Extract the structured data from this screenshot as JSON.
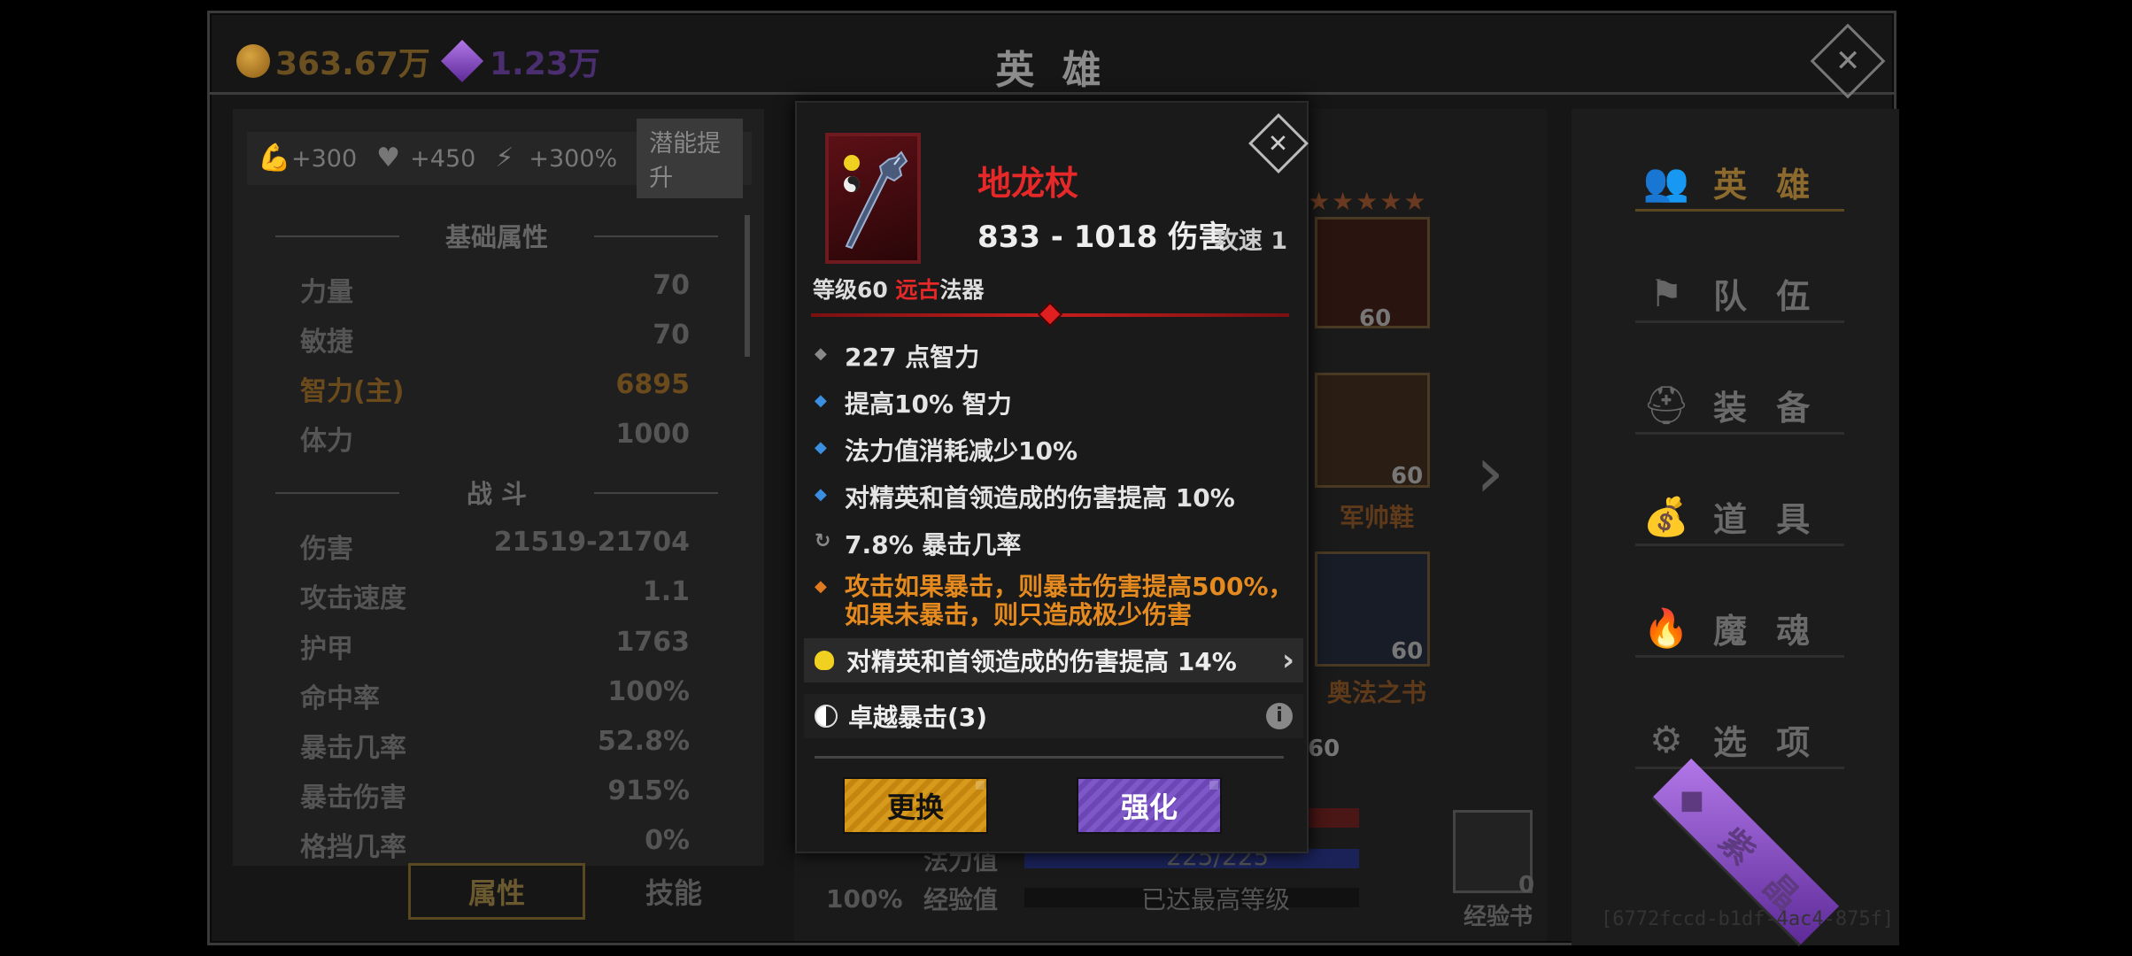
{
  "topbar": {
    "gold": "363.67万",
    "gems": "1.23万",
    "title": "英 雄"
  },
  "left": {
    "bonuses": [
      "+300",
      "+450",
      "+300%"
    ],
    "potential_btn": "潜能提升",
    "section_basic": "基础属性",
    "section_combat": "战 斗",
    "basic_stats": [
      {
        "label": "力量",
        "value": "70"
      },
      {
        "label": "敏捷",
        "value": "70"
      },
      {
        "label": "智力(主)",
        "value": "6895"
      },
      {
        "label": "体力",
        "value": "1000"
      }
    ],
    "combat_stats": [
      {
        "label": "伤害",
        "value": "21519-21704"
      },
      {
        "label": "攻击速度",
        "value": "1.1"
      },
      {
        "label": "护甲",
        "value": "1763"
      },
      {
        "label": "命中率",
        "value": "100%"
      },
      {
        "label": "暴击几率",
        "value": "52.8%"
      },
      {
        "label": "暴击伤害",
        "value": "915%"
      },
      {
        "label": "格挡几率",
        "value": "0%"
      }
    ],
    "tabs": [
      "属性",
      "技能"
    ]
  },
  "middle": {
    "slot_levels": [
      "60",
      "60",
      "60"
    ],
    "slot_names": [
      "军帅鞋",
      "奥法之书"
    ],
    "partial_level": "60",
    "mana_label": "法力值",
    "mana_value": "225/225",
    "exp_label": "经验值",
    "exp_value": "已达最高等级",
    "percent": "100%",
    "book_label": "经验书",
    "book_count": "0"
  },
  "menu": [
    "英 雄",
    "队 伍",
    "装 备",
    "道 具",
    "魔 魂",
    "选 项",
    "紫 晶"
  ],
  "uuid": "[6772fccd-b1df-4ac4-875f]",
  "popup": {
    "name": "地龙杖",
    "damage": "833 - 1018 伤害",
    "speed": "攻速 1",
    "type_prefix": "等级60 ",
    "type_ancient": "远古",
    "type_suffix": "法器",
    "affixes": [
      {
        "bullet": "grey",
        "text": "227 点智力"
      },
      {
        "bullet": "blue",
        "text": "提高10% 智力"
      },
      {
        "bullet": "blue",
        "text": "法力值消耗减少10%"
      },
      {
        "bullet": "blue",
        "text": "对精英和首领造成的伤害提高 10%"
      },
      {
        "bullet": "grey",
        "text": "7.8% 暴击几率"
      }
    ],
    "legendary_line1": "攻击如果暴击，则暴击伤害提高500%，",
    "legendary_line2": "如果未暴击，则只造成极少伤害",
    "enchant": "对精英和首领造成的伤害提高 14%",
    "set": "卓越暴击(3)",
    "replace_btn": "更换",
    "enhance_btn": "强化"
  }
}
